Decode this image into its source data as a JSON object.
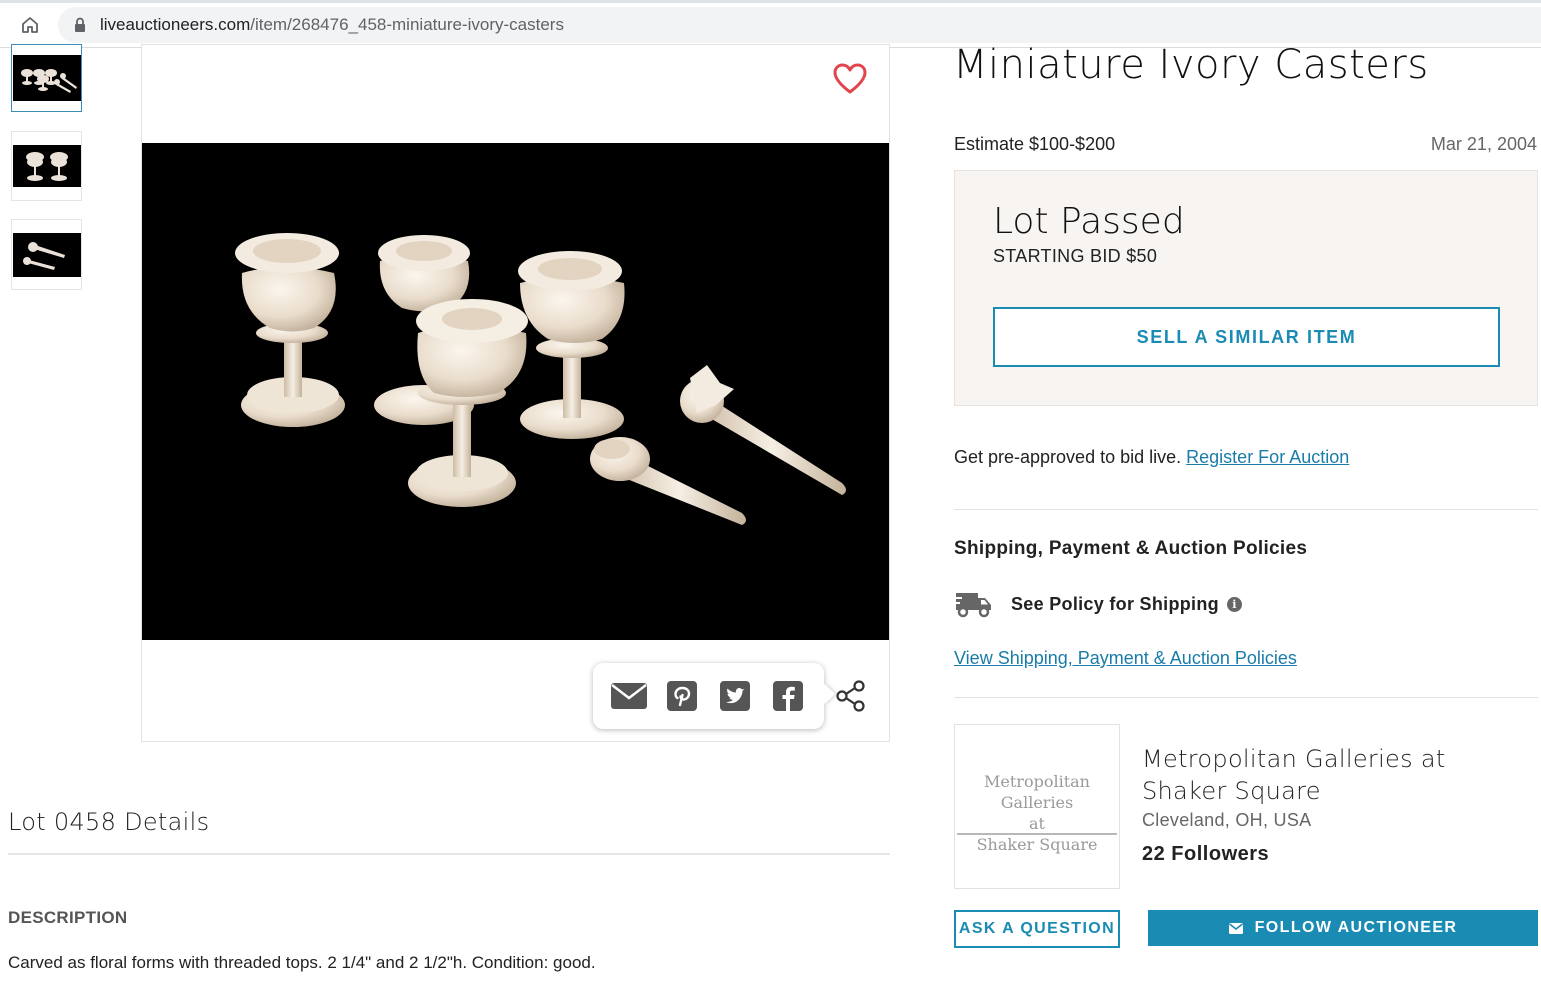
{
  "browser": {
    "url_domain": "liveauctioneers.com",
    "url_path": "/item/268476_458-miniature-ivory-casters"
  },
  "item": {
    "title": "Miniature Ivory Casters",
    "estimate": "Estimate $100-$200",
    "date": "Mar 21, 2004"
  },
  "status": {
    "headline": "Lot Passed",
    "starting_bid": "STARTING BID $50",
    "sell_button": "SELL A SIMILAR ITEM"
  },
  "register": {
    "text": "Get pre-approved to bid live.",
    "link": "Register For Auction"
  },
  "policies": {
    "heading": "Shipping, Payment & Auction Policies",
    "shipping_label": "See Policy for Shipping",
    "view_link": "View Shipping, Payment & Auction Policies"
  },
  "auctioneer": {
    "logo_text_line1": "Metropolitan Galleries",
    "logo_text_line2": "at",
    "logo_text_line3": "Shaker Square",
    "name": "Metropolitan Galleries at Shaker Square",
    "location": "Cleveland, OH, USA",
    "followers": "22 Followers",
    "ask_button": "ASK A QUESTION",
    "follow_button": "FOLLOW AUCTIONEER"
  },
  "details": {
    "lot_title": "Lot 0458 Details",
    "description_heading": "DESCRIPTION",
    "description_text": "Carved as floral forms with threaded tops. 2 1/4\" and 2 1/2\"h. Condition: good."
  },
  "share": {
    "icons": [
      "email-icon",
      "pinterest-icon",
      "twitter-icon",
      "facebook-icon"
    ]
  },
  "colors": {
    "accent": "#1a8bb3",
    "link": "#1a7ca8",
    "favorite": "#e0454d",
    "status_bg": "#f8f4f1"
  }
}
